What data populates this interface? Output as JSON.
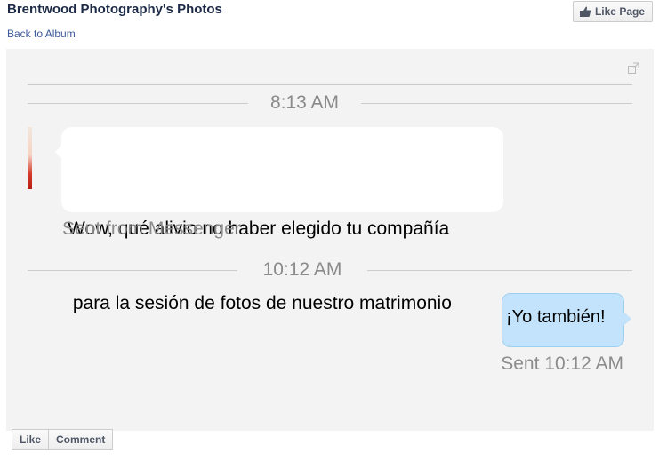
{
  "header": {
    "title": "Brentwood Photography's Photos",
    "back_link": "Back to Album",
    "like_page_label": "Like Page",
    "like_page_icon": "thumbs-up-icon"
  },
  "photo": {
    "expand_icon": "expand-icon",
    "conversation": {
      "time_separator_1": "8:13 AM",
      "incoming_message_line1": "Wow, qué alivio no haber elegido tu compañía",
      "incoming_message_line2": " para la sesión de fotos de nuestro matrimonio",
      "incoming_footer": "Sent from Messenger",
      "time_separator_2": "10:12 AM",
      "outgoing_message": "¡Yo también!",
      "outgoing_footer": "Sent 10:12 AM"
    }
  },
  "actions": {
    "like_label": "Like",
    "comment_label": "Comment"
  },
  "colors": {
    "link": "#3b5998",
    "incoming_bubble": "#ffffff",
    "outgoing_bubble": "#c2e3fb",
    "chat_background": "#f3f3f3"
  }
}
